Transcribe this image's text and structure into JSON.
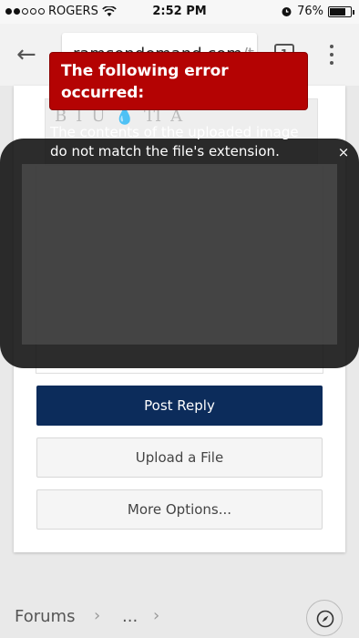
{
  "status_bar": {
    "carrier": "ROGERS",
    "time": "2:52 PM",
    "battery": "76%",
    "battery_level": 0.76
  },
  "browser": {
    "url": "ramsondemand.com",
    "url_overflow": "/t",
    "tab_count": "1"
  },
  "editor": {
    "toolbar_row1": [
      "B",
      "I",
      "U",
      "💧",
      "TI",
      "A"
    ]
  },
  "buttons": {
    "post_reply": "Post Reply",
    "upload_file": "Upload a File",
    "more_options": "More Options..."
  },
  "footer": {
    "forums": "Forums",
    "ellipsis": "...",
    "separator": "›"
  },
  "overlay": {
    "close": "×",
    "error_title": "The following error occurred:",
    "error_message": "The contents of the uploaded image do not match the file's extension."
  }
}
